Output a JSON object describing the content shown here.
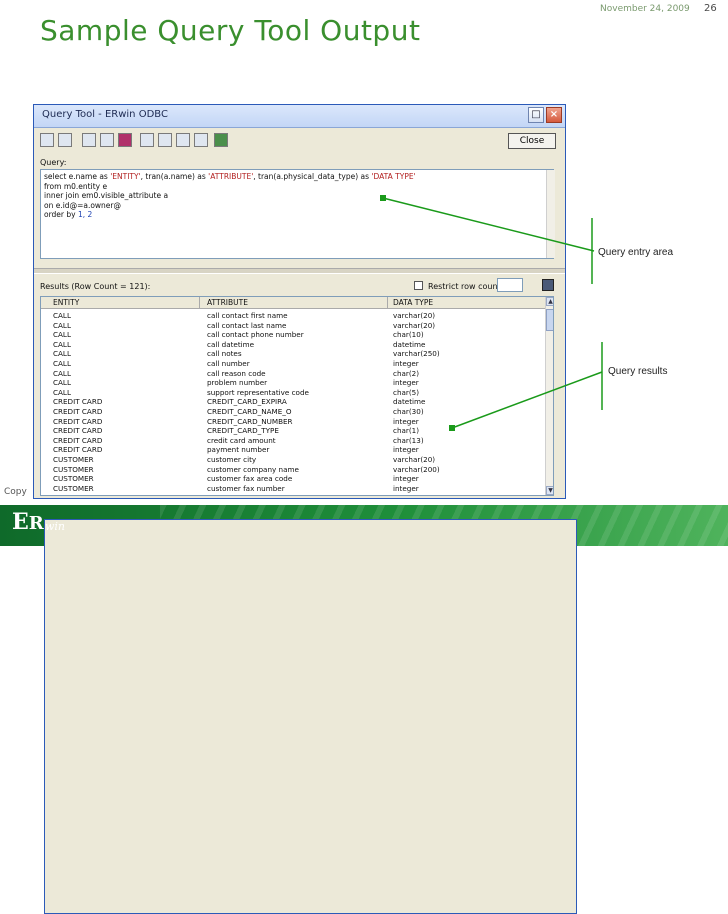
{
  "slide": {
    "title": "Sample Query Tool Output",
    "date": "November 24, 2009",
    "page_number": "26",
    "copyright": "Copy"
  },
  "window": {
    "title": "Query Tool - ERwin ODBC",
    "close_button": "Close",
    "query_label": "Query:",
    "results_label": "Results (Row Count = 121):",
    "restrict_label": "Restrict row count to:",
    "restrict_value": "",
    "query_lines": [
      {
        "parts": [
          [
            "k",
            "select e.name as "
          ],
          [
            "s",
            "'ENTITY'"
          ],
          [
            "k",
            ", tran(a.name) as "
          ],
          [
            "s",
            "'ATTRIBUTE'"
          ],
          [
            "k",
            ", tran(a.physical_data_type) as "
          ],
          [
            "s",
            "'DATA TYPE'"
          ]
        ]
      },
      {
        "parts": [
          [
            "k",
            "  from m0.entity e"
          ]
        ]
      },
      {
        "parts": [
          [
            "k",
            "    inner join em0.visible_attribute a"
          ]
        ]
      },
      {
        "parts": [
          [
            "k",
            "      on e.id@=a.owner@"
          ]
        ]
      },
      {
        "parts": [
          [
            "k",
            "    order by "
          ],
          [
            "n",
            "1, 2"
          ]
        ]
      }
    ],
    "columns": [
      "ENTITY",
      "ATTRIBUTE",
      "DATA TYPE"
    ],
    "rows": [
      [
        "CALL",
        "call contact first name",
        "varchar(20)"
      ],
      [
        "CALL",
        "call contact last name",
        "varchar(20)"
      ],
      [
        "CALL",
        "call contact phone number",
        "char(10)"
      ],
      [
        "CALL",
        "call datetime",
        "datetime"
      ],
      [
        "CALL",
        "call notes",
        "varchar(250)"
      ],
      [
        "CALL",
        "call number",
        "integer"
      ],
      [
        "CALL",
        "call reason code",
        "char(2)"
      ],
      [
        "CALL",
        "problem number",
        "integer"
      ],
      [
        "CALL",
        "support representative code",
        "char(5)"
      ],
      [
        "CREDIT CARD",
        "CREDIT_CARD_EXPIRA",
        "datetime"
      ],
      [
        "CREDIT CARD",
        "CREDIT_CARD_NAME_O",
        "char(30)"
      ],
      [
        "CREDIT CARD",
        "CREDIT_CARD_NUMBER",
        "integer"
      ],
      [
        "CREDIT CARD",
        "CREDIT_CARD_TYPE",
        "char(1)"
      ],
      [
        "CREDIT CARD",
        "credit card amount",
        "char(13)"
      ],
      [
        "CREDIT CARD",
        "payment number",
        "integer"
      ],
      [
        "CUSTOMER",
        "customer city",
        "varchar(20)"
      ],
      [
        "CUSTOMER",
        "customer company name",
        "varchar(200)"
      ],
      [
        "CUSTOMER",
        "customer fax area code",
        "integer"
      ],
      [
        "CUSTOMER",
        "customer fax number",
        "integer"
      ]
    ]
  },
  "annotations": {
    "query_entry": "Query entry area",
    "query_results": "Query results"
  },
  "colors": {
    "title_green": "#3a8f2e",
    "annotation_line": "#1a9a1a",
    "footer_green": "#1f8f3a"
  },
  "logo_text": "ERwin"
}
